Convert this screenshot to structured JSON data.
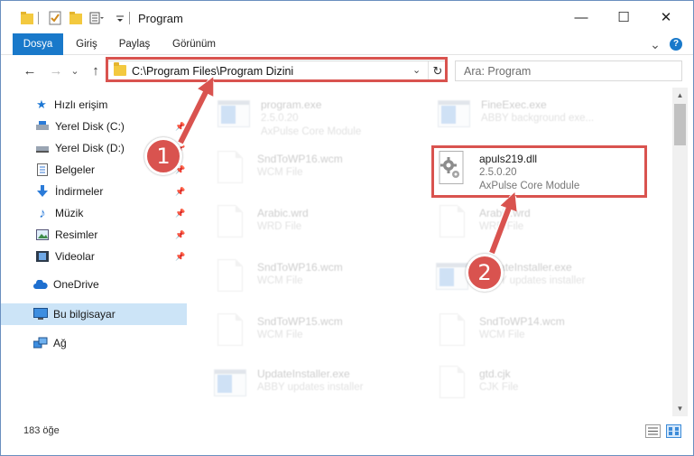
{
  "window": {
    "title": "Program",
    "controls": {
      "minimize": "—",
      "maximize": "☐",
      "close": "✕"
    }
  },
  "ribbon": {
    "tabs": [
      {
        "label": "Dosya"
      },
      {
        "label": "Giriş"
      },
      {
        "label": "Paylaş"
      },
      {
        "label": "Görünüm"
      }
    ],
    "expand": "⌄",
    "help": "?"
  },
  "nav": {
    "back": "←",
    "forward": "→",
    "recent": "⌄",
    "up": "↑",
    "address": "C:\\Program Files\\Program Dizini",
    "refresh": "↻",
    "dropdown": "⌄",
    "search_placeholder": "Ara: Program"
  },
  "sidebar": {
    "items": [
      {
        "label": "Hızlı erişim",
        "icon": "star-icon"
      },
      {
        "label": "Yerel Disk (C:)",
        "icon": "drive-icon"
      },
      {
        "label": "Yerel Disk (D:)",
        "icon": "drive-icon"
      },
      {
        "label": "Belgeler",
        "icon": "documents-icon"
      },
      {
        "label": "İndirmeler",
        "icon": "download-icon"
      },
      {
        "label": "Müzik",
        "icon": "music-icon"
      },
      {
        "label": "Resimler",
        "icon": "pictures-icon"
      },
      {
        "label": "Videolar",
        "icon": "videos-icon"
      },
      {
        "label": "OneDrive",
        "icon": "cloud-icon"
      },
      {
        "label": "Bu bilgisayar",
        "icon": "computer-icon"
      },
      {
        "label": "Ağ",
        "icon": "network-icon"
      }
    ]
  },
  "files": [
    {
      "name": "program.exe",
      "line1": "2.5.0.20",
      "line2": "AxPulse Core Module",
      "kind": "app"
    },
    {
      "name": "FineExec.exe",
      "line1": "ABBY background exe...",
      "line2": "",
      "kind": "app"
    },
    {
      "name": "SndToWP16.wcm",
      "line1": "WCM File",
      "line2": "",
      "kind": "doc"
    },
    {
      "name": "apuls219.dll",
      "line1": "2.5.0.20",
      "line2": "AxPulse Core Module",
      "kind": "dll"
    },
    {
      "name": "Arabic.wrd",
      "line1": "WRD File",
      "line2": "",
      "kind": "doc"
    },
    {
      "name": "Arabic.wrd",
      "line1": "WRD File",
      "line2": "",
      "kind": "doc"
    },
    {
      "name": "SndToWP16.wcm",
      "line1": "WCM File",
      "line2": "",
      "kind": "doc"
    },
    {
      "name": "UpdateInstaller.exe",
      "line1": "ABBY updates installer",
      "line2": "",
      "kind": "app"
    },
    {
      "name": "SndToWP15.wcm",
      "line1": "WCM File",
      "line2": "",
      "kind": "doc"
    },
    {
      "name": "SndToWP14.wcm",
      "line1": "WCM File",
      "line2": "",
      "kind": "doc"
    },
    {
      "name": "UpdateInstaller.exe",
      "line1": "ABBY updates installer",
      "line2": "",
      "kind": "app"
    },
    {
      "name": "gtd.cjk",
      "line1": "CJK File",
      "line2": "",
      "kind": "doc"
    }
  ],
  "status": {
    "count": "183 öğe"
  },
  "callouts": [
    {
      "number": "1"
    },
    {
      "number": "2"
    }
  ],
  "colors": {
    "accent": "#1979ca",
    "highlight": "#d9534f",
    "selection": "#cce4f7"
  }
}
